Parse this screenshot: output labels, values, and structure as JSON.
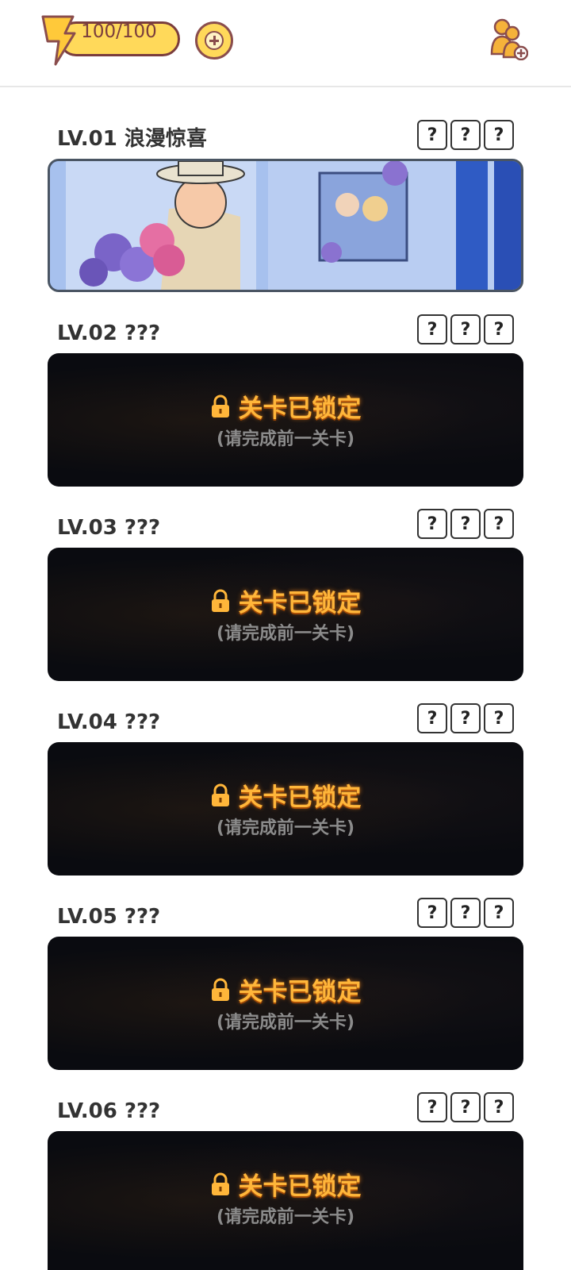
{
  "header": {
    "energy": "100/100",
    "icons": [
      "lightning-bolt-icon",
      "plus-icon",
      "add-friends-icon"
    ],
    "accent": "#ffd95a"
  },
  "levels": [
    {
      "title": "LV.01 浪漫惊喜",
      "locked": false,
      "qmarks": [
        "?",
        "?",
        "?"
      ]
    },
    {
      "title": "LV.02 ???",
      "locked": true,
      "lock_label": "关卡已锁定",
      "lock_hint": "(请完成前一关卡)",
      "qmarks": [
        "?",
        "?",
        "?"
      ]
    },
    {
      "title": "LV.03 ???",
      "locked": true,
      "lock_label": "关卡已锁定",
      "lock_hint": "(请完成前一关卡)",
      "qmarks": [
        "?",
        "?",
        "?"
      ]
    },
    {
      "title": "LV.04 ???",
      "locked": true,
      "lock_label": "关卡已锁定",
      "lock_hint": "(请完成前一关卡)",
      "qmarks": [
        "?",
        "?",
        "?"
      ]
    },
    {
      "title": "LV.05 ???",
      "locked": true,
      "lock_label": "关卡已锁定",
      "lock_hint": "(请完成前一关卡)",
      "qmarks": [
        "?",
        "?",
        "?"
      ]
    },
    {
      "title": "LV.06 ???",
      "locked": true,
      "lock_label": "关卡已锁定",
      "lock_hint": "(请完成前一关卡)",
      "qmarks": [
        "?",
        "?",
        "?"
      ]
    }
  ]
}
